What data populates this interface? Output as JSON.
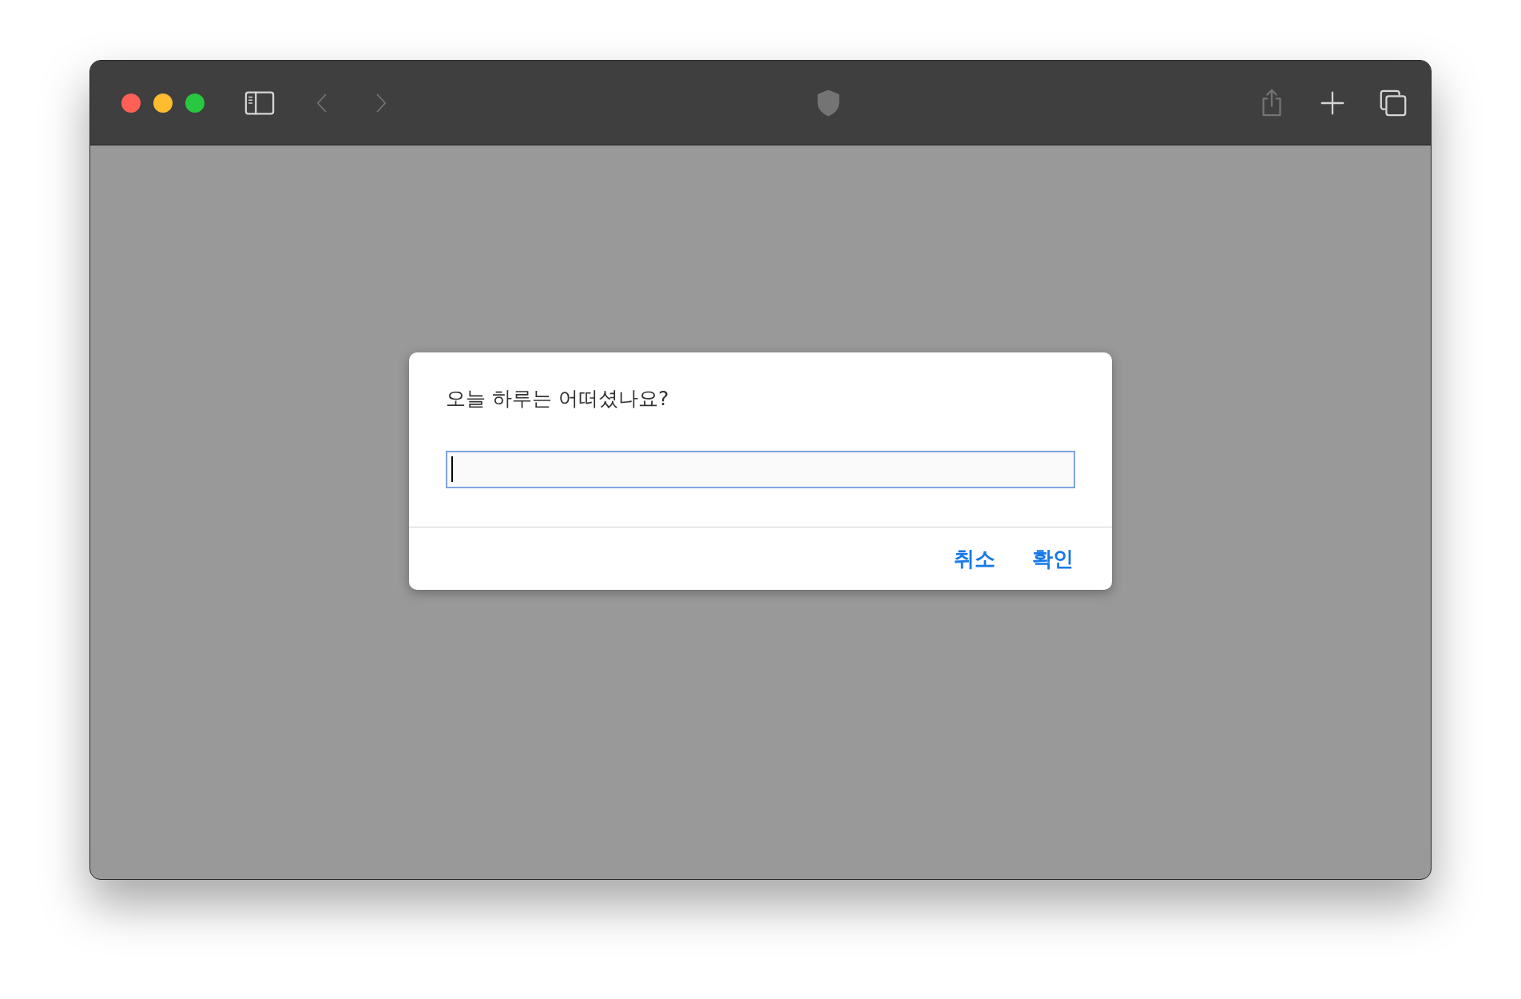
{
  "toolbar": [
    {
      "kind": "sidebar",
      "disabled": false
    },
    {
      "kind": "back",
      "disabled": true
    },
    {
      "kind": "forward",
      "disabled": true
    },
    {
      "kind": "privacy",
      "disabled": true
    },
    {
      "kind": "share",
      "disabled": true
    },
    {
      "kind": "new-tab",
      "disabled": false
    },
    {
      "kind": "tabs",
      "disabled": false
    }
  ],
  "prompt": {
    "message": "오늘 하루는 어떠셨나요?",
    "field": {
      "focused": true
    },
    "buttons": [
      {
        "label": "취소"
      },
      {
        "label": "확인"
      }
    ]
  }
}
